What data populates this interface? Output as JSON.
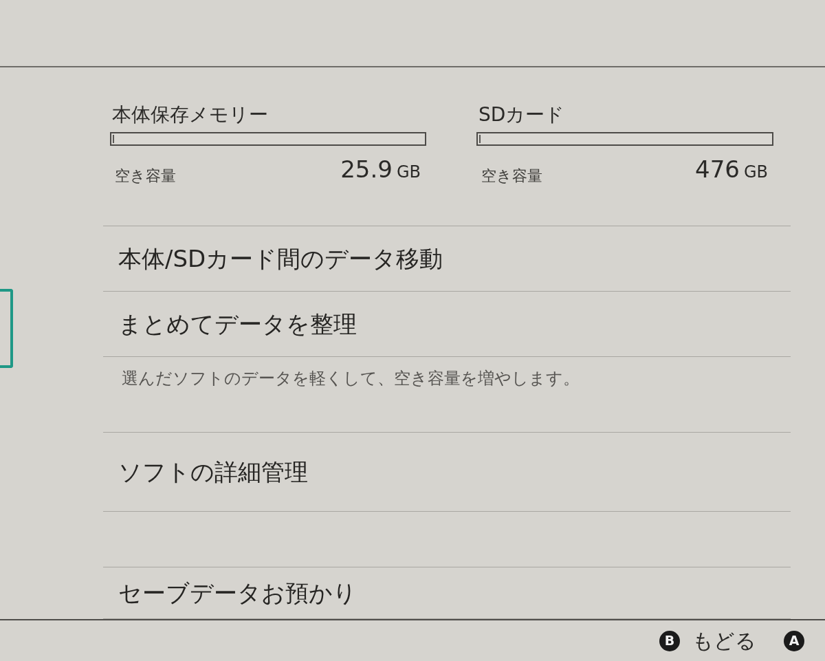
{
  "sidebar": {
    "items": [
      {
        "selected": true
      }
    ]
  },
  "storage": [
    {
      "name": "本体保存メモリー",
      "level": 0.005,
      "free_label": "空き容量",
      "free_space": "25.9",
      "unit": "GB"
    },
    {
      "name": "SDカード",
      "level": 0.005,
      "free_label": "空き容量",
      "free_space": "476",
      "unit": "GB"
    }
  ],
  "sections": [
    {
      "items": [
        {
          "label": "本体/SDカード間のデータ移動"
        },
        {
          "label": "まとめてデータを整理",
          "description": "選んだソフトのデータを軽くして、空き容量を増やします。"
        },
        {
          "label": "ソフトの詳細管理"
        }
      ]
    },
    {
      "items": [
        {
          "label": "セーブデータお預かり"
        }
      ]
    }
  ],
  "footer": {
    "buttons": [
      {
        "key": "B",
        "label": "もどる"
      },
      {
        "key": "A"
      }
    ]
  }
}
